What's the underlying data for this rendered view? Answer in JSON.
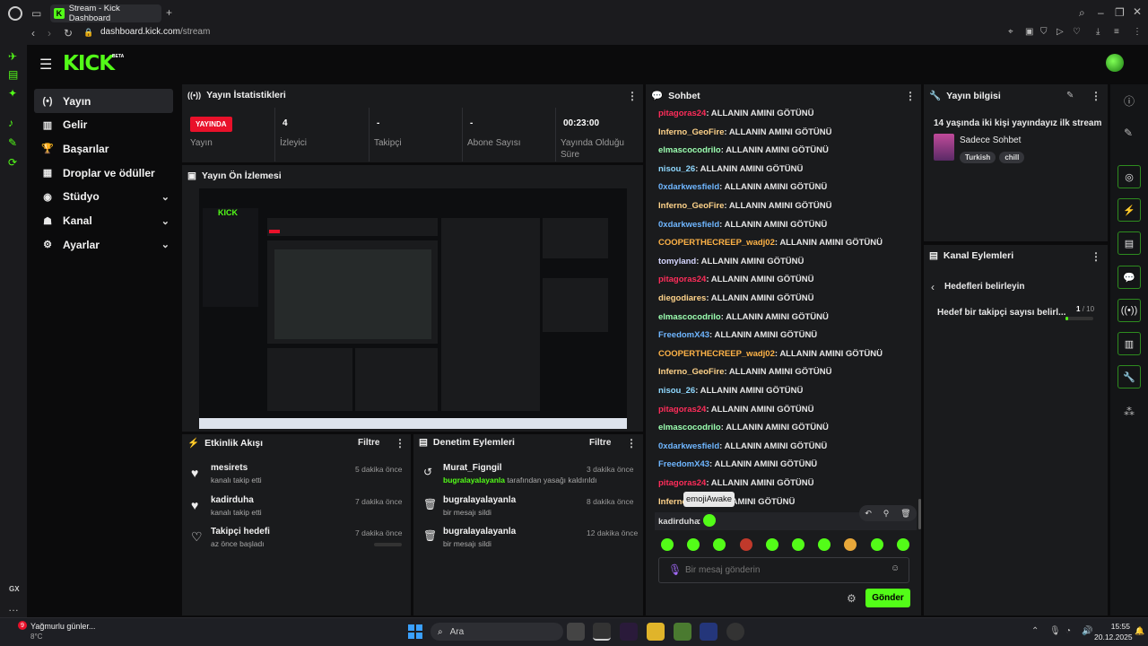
{
  "browser": {
    "tab_title": "Stream - Kick Dashboard",
    "url_host": "dashboard.kick.com",
    "url_path": "/stream",
    "gx_label": "GX"
  },
  "brand": {
    "logo": "KICK",
    "beta": "BETA",
    "accent": "#53fc18"
  },
  "nav": {
    "items": [
      {
        "label": "Yayın",
        "icon": "broadcast-icon",
        "active": true
      },
      {
        "label": "Gelir",
        "icon": "revenue-icon"
      },
      {
        "label": "Başarılar",
        "icon": "trophy-icon"
      },
      {
        "label": "Droplar ve ödüller",
        "icon": "gift-icon"
      },
      {
        "label": "Stüdyo",
        "icon": "studio-icon",
        "expandable": true
      },
      {
        "label": "Kanal",
        "icon": "channel-icon",
        "expandable": true
      },
      {
        "label": "Ayarlar",
        "icon": "gear-icon",
        "expandable": true
      }
    ]
  },
  "stats": {
    "title": "Yayın İstatistikleri",
    "live_badge": "YAYINDA",
    "cols": [
      {
        "value": "",
        "label": "Yayın"
      },
      {
        "value": "4",
        "label": "İzleyici"
      },
      {
        "value": "-",
        "label": "Takipçi"
      },
      {
        "value": "-",
        "label": "Abone Sayısı"
      },
      {
        "value": "00:23:00",
        "label": "Yayında Olduğu Süre"
      }
    ]
  },
  "preview": {
    "title": "Yayın Ön İzlemesi"
  },
  "activity": {
    "title": "Etkinlik Akışı",
    "filter": "Filtre",
    "items": [
      {
        "name": "mesirets",
        "sub": "kanalı takip etti",
        "time": "5 dakika önce",
        "icon": "heart-icon"
      },
      {
        "name": "kadirduha",
        "sub": "kanalı takip etti",
        "time": "7 dakika önce",
        "icon": "heart-icon"
      },
      {
        "name": "Takipçi hedefi",
        "sub": "az önce başladı",
        "time": "7 dakika önce",
        "icon": "heart-outline-icon"
      }
    ]
  },
  "moderation": {
    "title": "Denetim Eylemleri",
    "filter": "Filtre",
    "items": [
      {
        "name": "Murat_Figngil",
        "sub_hl": "bugralayalayanla",
        "sub": " tarafından yasağı kaldırıldı",
        "time": "3 dakika önce",
        "icon": "undo-icon"
      },
      {
        "name": "bugralayalayanla",
        "sub_hl": "",
        "sub": "bir mesajı sildi",
        "time": "8 dakika önce",
        "icon": "trash-icon"
      },
      {
        "name": "bugralayalayanla",
        "sub_hl": "",
        "sub": "bir mesajı sildi",
        "time": "12 dakika önce",
        "icon": "trash-icon"
      }
    ]
  },
  "chat": {
    "title": "Sohbet",
    "message": ": ALLANIN AMINI GÖTÜNÜ",
    "messages": [
      {
        "user": "pitagoras24",
        "color": "#ff2d5a"
      },
      {
        "user": "Inferno_GeoFire",
        "color": "#ffd38a"
      },
      {
        "user": "elmascocodrilo",
        "color": "#9bffb0"
      },
      {
        "user": "nisou_26",
        "color": "#8fd8ff"
      },
      {
        "user": "0xdarkwesfield",
        "color": "#6fb6ff"
      },
      {
        "user": "Inferno_GeoFire",
        "color": "#ffd38a"
      },
      {
        "user": "0xdarkwesfield",
        "color": "#6fb6ff"
      },
      {
        "user": "COOPERTHECREEP_wadj02",
        "color": "#ffb347"
      },
      {
        "user": "tomyland",
        "color": "#d6d6ff"
      },
      {
        "user": "pitagoras24",
        "color": "#ff2d5a"
      },
      {
        "user": "diegodiares",
        "color": "#ffd38a"
      },
      {
        "user": "elmascocodrilo",
        "color": "#9bffb0"
      },
      {
        "user": "FreedomX43",
        "color": "#6fb6ff"
      },
      {
        "user": "COOPERTHECREEP_wadj02",
        "color": "#ffb347"
      },
      {
        "user": "Inferno_GeoFire",
        "color": "#ffd38a"
      },
      {
        "user": "nisou_26",
        "color": "#8fd8ff"
      },
      {
        "user": "pitagoras24",
        "color": "#ff2d5a"
      },
      {
        "user": "elmascocodrilo",
        "color": "#9bffb0"
      },
      {
        "user": "0xdarkwesfield",
        "color": "#6fb6ff"
      },
      {
        "user": "FreedomX43",
        "color": "#6fb6ff"
      },
      {
        "user": "pitagoras24",
        "color": "#ff2d5a"
      },
      {
        "user": "Inferno",
        "color": "#ffd38a"
      }
    ],
    "last_user": "kadirduha",
    "tooltip": "emojiAwake",
    "placeholder": "Bir mesaj gönderin",
    "send": "Gönder"
  },
  "stream_info": {
    "title": "Yayın bilgisi",
    "stream_title": "14 yaşında iki kişi yayındayız ilk stream",
    "category": "Sadece Sohbet",
    "tags": [
      "Turkish",
      "chill"
    ]
  },
  "channel_actions": {
    "title": "Kanal Eylemleri",
    "back_label": "Hedefleri belirleyin",
    "goal_label": "Hedef bir takipçi sayısı belirl...",
    "goal_current": "1",
    "goal_total": "/ 10",
    "goal_progress": 0.1
  },
  "taskbar": {
    "weather_title": "Yağmurlu günler...",
    "weather_temp": "8°C",
    "weather_badge": "9",
    "search": "Ara",
    "time": "15:55",
    "date": "20.12.2025"
  }
}
